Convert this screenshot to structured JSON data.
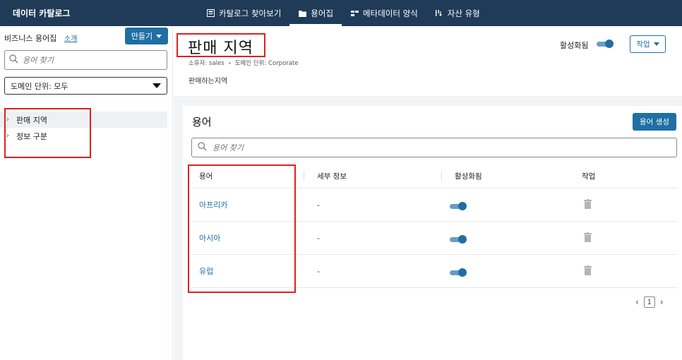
{
  "app": {
    "brand": "데이터 카탈로그"
  },
  "nav": {
    "items": [
      {
        "label": "카탈로그 찾아보기",
        "icon": "catalog-icon",
        "active": false
      },
      {
        "label": "용어집",
        "icon": "folder-icon",
        "active": true
      },
      {
        "label": "메타데이터 양식",
        "icon": "form-icon",
        "active": false
      },
      {
        "label": "자산 유형",
        "icon": "asset-type-icon",
        "active": false
      }
    ]
  },
  "sidebar": {
    "title": "비즈니스 용어집",
    "intro_link": "소개",
    "create_label": "만들기",
    "search_placeholder": "용어 찾기",
    "domain_filter": "도메인 단위: 모두",
    "items": [
      {
        "label": "판매 지역",
        "selected": true
      },
      {
        "label": "정보 구분",
        "selected": false
      }
    ]
  },
  "header": {
    "title": "판매 지역",
    "owner": "소유자: sales",
    "domain_unit": "도메인 단위: Corporate",
    "description": "판매하는지역",
    "enabled_label": "활성화됨",
    "enabled": true,
    "actions_label": "작업"
  },
  "terms": {
    "title": "용어",
    "create_label": "용어 생성",
    "search_placeholder": "용어 찾기",
    "columns": [
      "용어",
      "세부 정보",
      "활성화됨",
      "작업"
    ],
    "rows": [
      {
        "term": "아프리카",
        "details": "-",
        "enabled": true
      },
      {
        "term": "아시아",
        "details": "-",
        "enabled": true
      },
      {
        "term": "유럽",
        "details": "-",
        "enabled": true
      }
    ],
    "page": "1"
  },
  "colors": {
    "topbar": "#1f3b57",
    "accent": "#1f6fa3",
    "link": "#1d6fa5",
    "highlight_box": "#e02020"
  }
}
